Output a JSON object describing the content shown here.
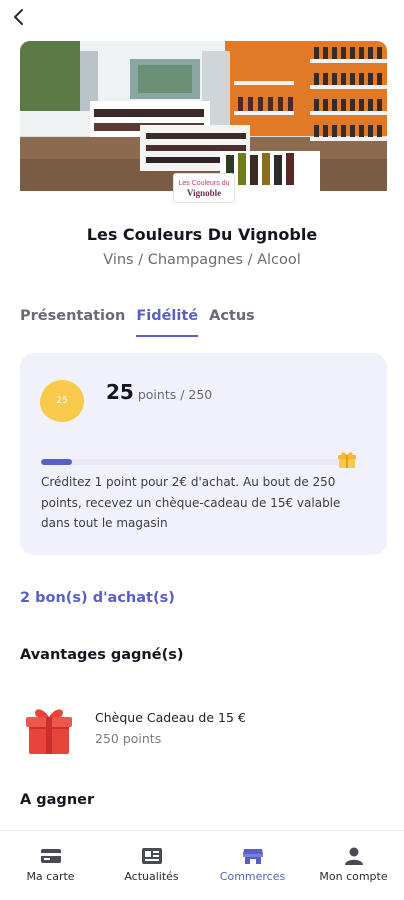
{
  "header": {
    "back_icon": "chevron-left-icon"
  },
  "store": {
    "name": "Les Couleurs Du Vignoble",
    "category": "Vins / Champagnes / Alcool",
    "logo": {
      "line1": "Les Couleurs du",
      "line2": "Vignoble"
    }
  },
  "tabs": [
    {
      "label": "Présentation",
      "active": false
    },
    {
      "label": "Fidélité",
      "active": true
    },
    {
      "label": "Actus",
      "active": false
    }
  ],
  "loyalty": {
    "badge_value": "25",
    "points": "25",
    "points_unit": "points / 250",
    "progress_fraction": 0.1,
    "description": "Créditez 1 point pour 2€ d'achat. Au bout de 250 points, recevez un chèque-cadeau de 15€ valable dans tout le magasin"
  },
  "vouchers": {
    "label": "2 bon(s) d'achat(s)"
  },
  "earned": {
    "title": "Avantages gagné(s)",
    "items": [
      {
        "title": "Chèque Cadeau de 15 €",
        "subtitle": "250 points",
        "icon": "gift-icon"
      }
    ]
  },
  "to_earn": {
    "title": "A gagner"
  },
  "bottom_nav": [
    {
      "label": "Ma carte",
      "icon": "card-icon",
      "active": false
    },
    {
      "label": "Actualités",
      "icon": "newspaper-icon",
      "active": false
    },
    {
      "label": "Commerces",
      "icon": "store-icon",
      "active": true
    },
    {
      "label": "Mon compte",
      "icon": "user-icon",
      "active": false
    }
  ],
  "colors": {
    "accent": "#5a5fc8",
    "card_bg": "#f1f1fb",
    "badge": "#f8c94a",
    "gift": "#e8443a"
  }
}
